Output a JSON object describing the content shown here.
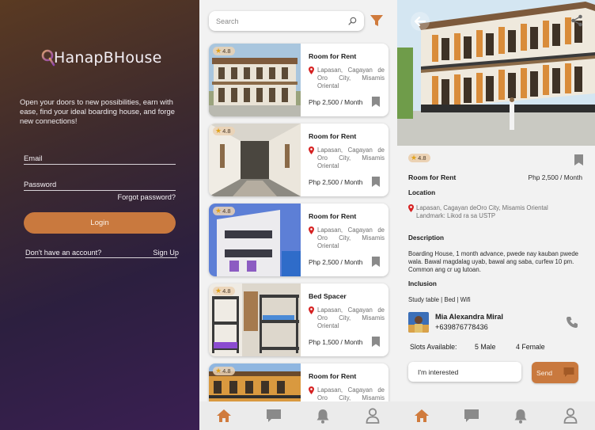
{
  "colors": {
    "accent": "#c9793e",
    "tab_icon": "#d07b3d",
    "gray_icon": "#8a8a8a",
    "pin_red": "#d62222",
    "star": "#e0a31c"
  },
  "login": {
    "logo_text": "HanapBHouse",
    "tagline": "Open your doors to new possibilities, earn with ease, find your ideal boarding house, and forge new connections!",
    "email_label": "Email",
    "password_label": "Password",
    "forgot_label": "Forgot password?",
    "login_button": "Login",
    "no_account_label": "Don't have an account?",
    "signup_label": "Sign Up"
  },
  "list": {
    "search_placeholder": "Search",
    "cards": [
      {
        "rating": "4.8",
        "title": "Room for Rent",
        "location": "Lapasan, Cagayan de Oro City, Misamis Oriental",
        "price": "Php 2,500 / Month"
      },
      {
        "rating": "4.8",
        "title": "Room for Rent",
        "location": "Lapasan, Cagayan de Oro City, Misamis Oriental",
        "price": "Php 2,500 / Month"
      },
      {
        "rating": "4.8",
        "title": "Room for Rent",
        "location": "Lapasan, Cagayan de Oro City, Misamis Oriental",
        "price": "Php 2,500 / Month"
      },
      {
        "rating": "4.8",
        "title": "Bed Spacer",
        "location": "Lapasan, Cagayan de Oro City, Misamis Oriental",
        "price": "Php 1,500 / Month"
      },
      {
        "rating": "4.8",
        "title": "Room for Rent",
        "location": "Lapasan, Cagayan de Oro City, Misamis Oriental",
        "price": ""
      }
    ],
    "tabs": [
      "home-icon",
      "chat-icon",
      "bell-icon",
      "user-icon"
    ]
  },
  "detail": {
    "rating": "4.8",
    "title": "Room for Rent",
    "price": "Php 2,500 / Month",
    "location_heading": "Location",
    "location_line1": "Lapasan, Cagayan deOro City, Misamis Oriental",
    "location_line2": "Landmark: Likod ra sa USTP",
    "description_heading": "Description",
    "description": "Boarding House, 1 month advance, pwede nay kauban pwede wala. Bawal magdalag uyab, bawal ang saba, curfew 10 pm. Common ang cr ug lutoan.",
    "inclusion_heading": "Inclusion",
    "inclusion": "Study table | Bed | Wifi",
    "owner_name": "Mia Alexandra Miral",
    "owner_phone": "+639876778436",
    "slots_label": "Slots Available:",
    "slots_male": "5 Male",
    "slots_female": "4 Female",
    "message_text": "I'm interested",
    "send_label": "Send",
    "tabs": [
      "home-icon",
      "chat-icon",
      "bell-icon",
      "user-icon"
    ]
  }
}
